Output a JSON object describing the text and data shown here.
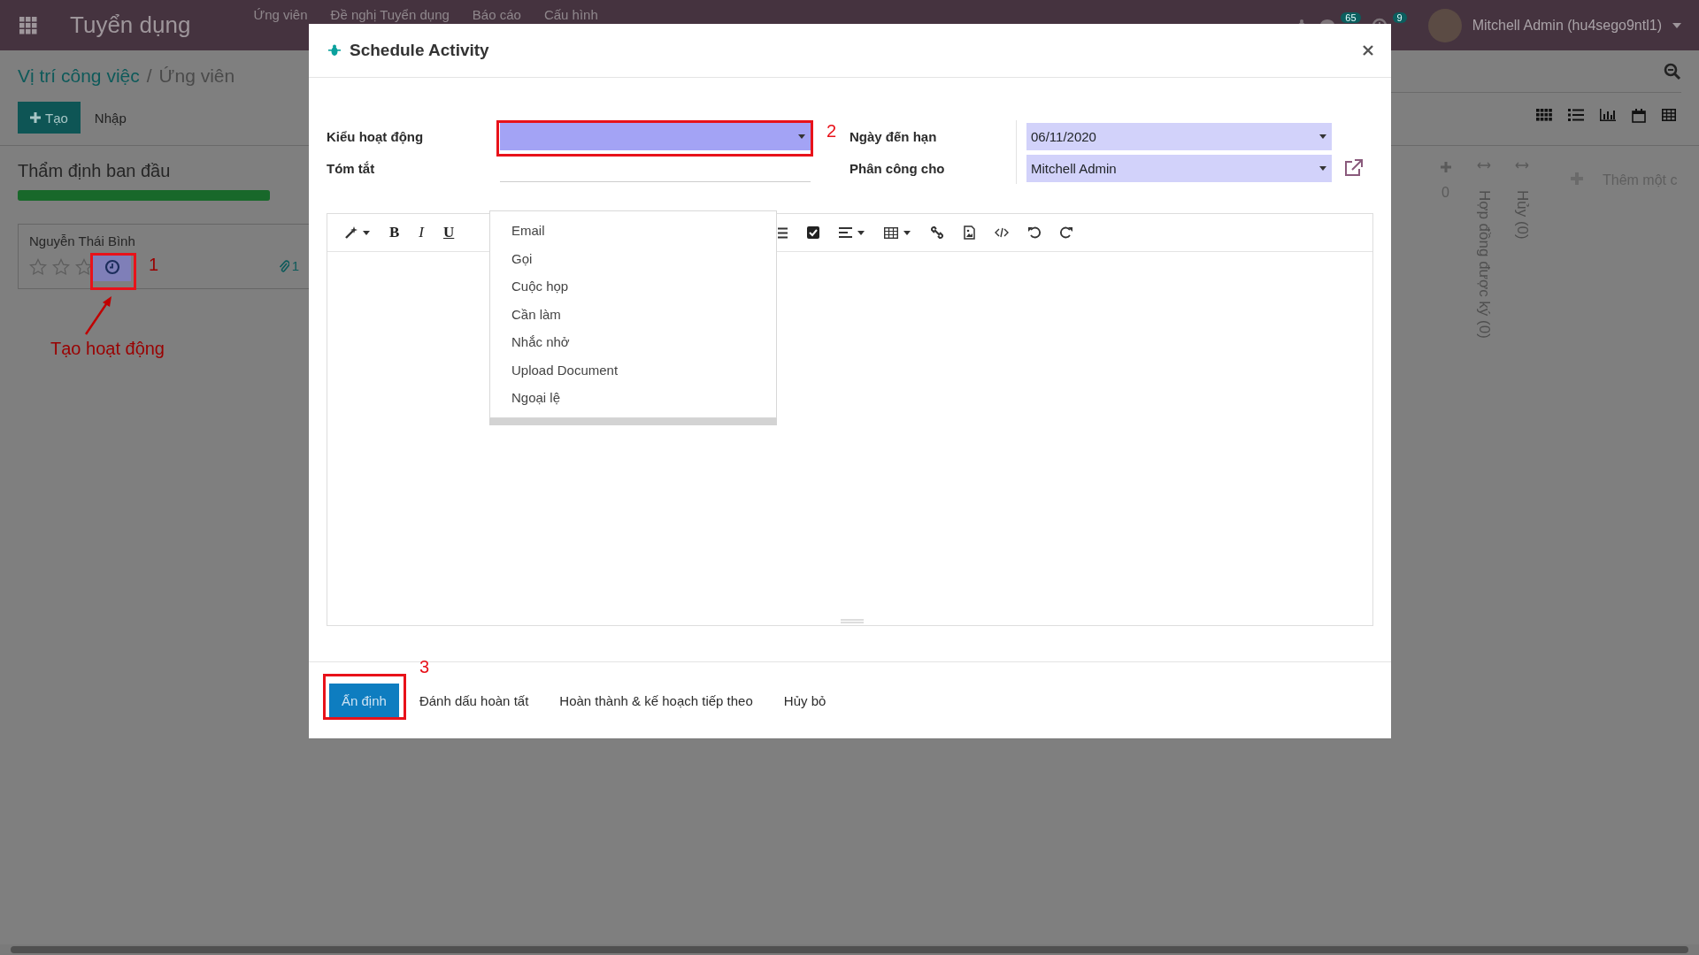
{
  "navbar": {
    "app_title": "Tuyển dụng",
    "menu": [
      "Ứng viên",
      "Đề nghị Tuyển dụng",
      "Báo cáo",
      "Cấu hình"
    ],
    "message_count": "65",
    "activity_count": "9",
    "user": "Mitchell Admin (hu4sego9ntl1)"
  },
  "control_panel": {
    "breadcrumb": [
      "Vị trí công việc",
      "Ứng viên"
    ],
    "breadcrumb_separator": "/",
    "create_button": "Tạo",
    "import_button": "Nhập"
  },
  "kanban": {
    "column": {
      "title": "Thẩm định ban đầu",
      "level": 1
    },
    "card": {
      "name": "Nguyễn Thái Bình",
      "stars": 0,
      "attachment_count": "1"
    },
    "next_column_count": "0",
    "folded_columns": [
      {
        "title": "Hợp đồng được ký (0)"
      },
      {
        "title": "Hủy (0)"
      }
    ],
    "add_column": "Thêm một c"
  },
  "dialog": {
    "title": "Schedule Activity",
    "activity_type": {
      "label": "Kiểu hoạt động"
    },
    "summary": {
      "label": "Tóm tắt"
    },
    "due_date": {
      "label": "Ngày đến hạn",
      "value": "06/11/2020"
    },
    "assigned_to": {
      "label": "Phân công cho",
      "value": "Mitchell Admin"
    },
    "format_buttons": [
      "B",
      "I",
      "U"
    ],
    "options": [
      "Email",
      "Gọi",
      "Cuộc họp",
      "Cần làm",
      "Nhắc nhở",
      "Upload Document",
      "Ngoại lệ"
    ],
    "buttons": [
      {
        "label": "Ấn định",
        "kind": "primary"
      },
      {
        "label": "Đánh dấu hoàn tất",
        "kind": "secondary"
      },
      {
        "label": "Hoàn thành & kế hoạch tiếp theo",
        "kind": "secondary"
      },
      {
        "label": "Hủy bỏ",
        "kind": "secondary"
      }
    ]
  },
  "annotations": {
    "numbers": [
      "1",
      "2",
      "3"
    ],
    "caption": "Tạo hoạt động"
  }
}
